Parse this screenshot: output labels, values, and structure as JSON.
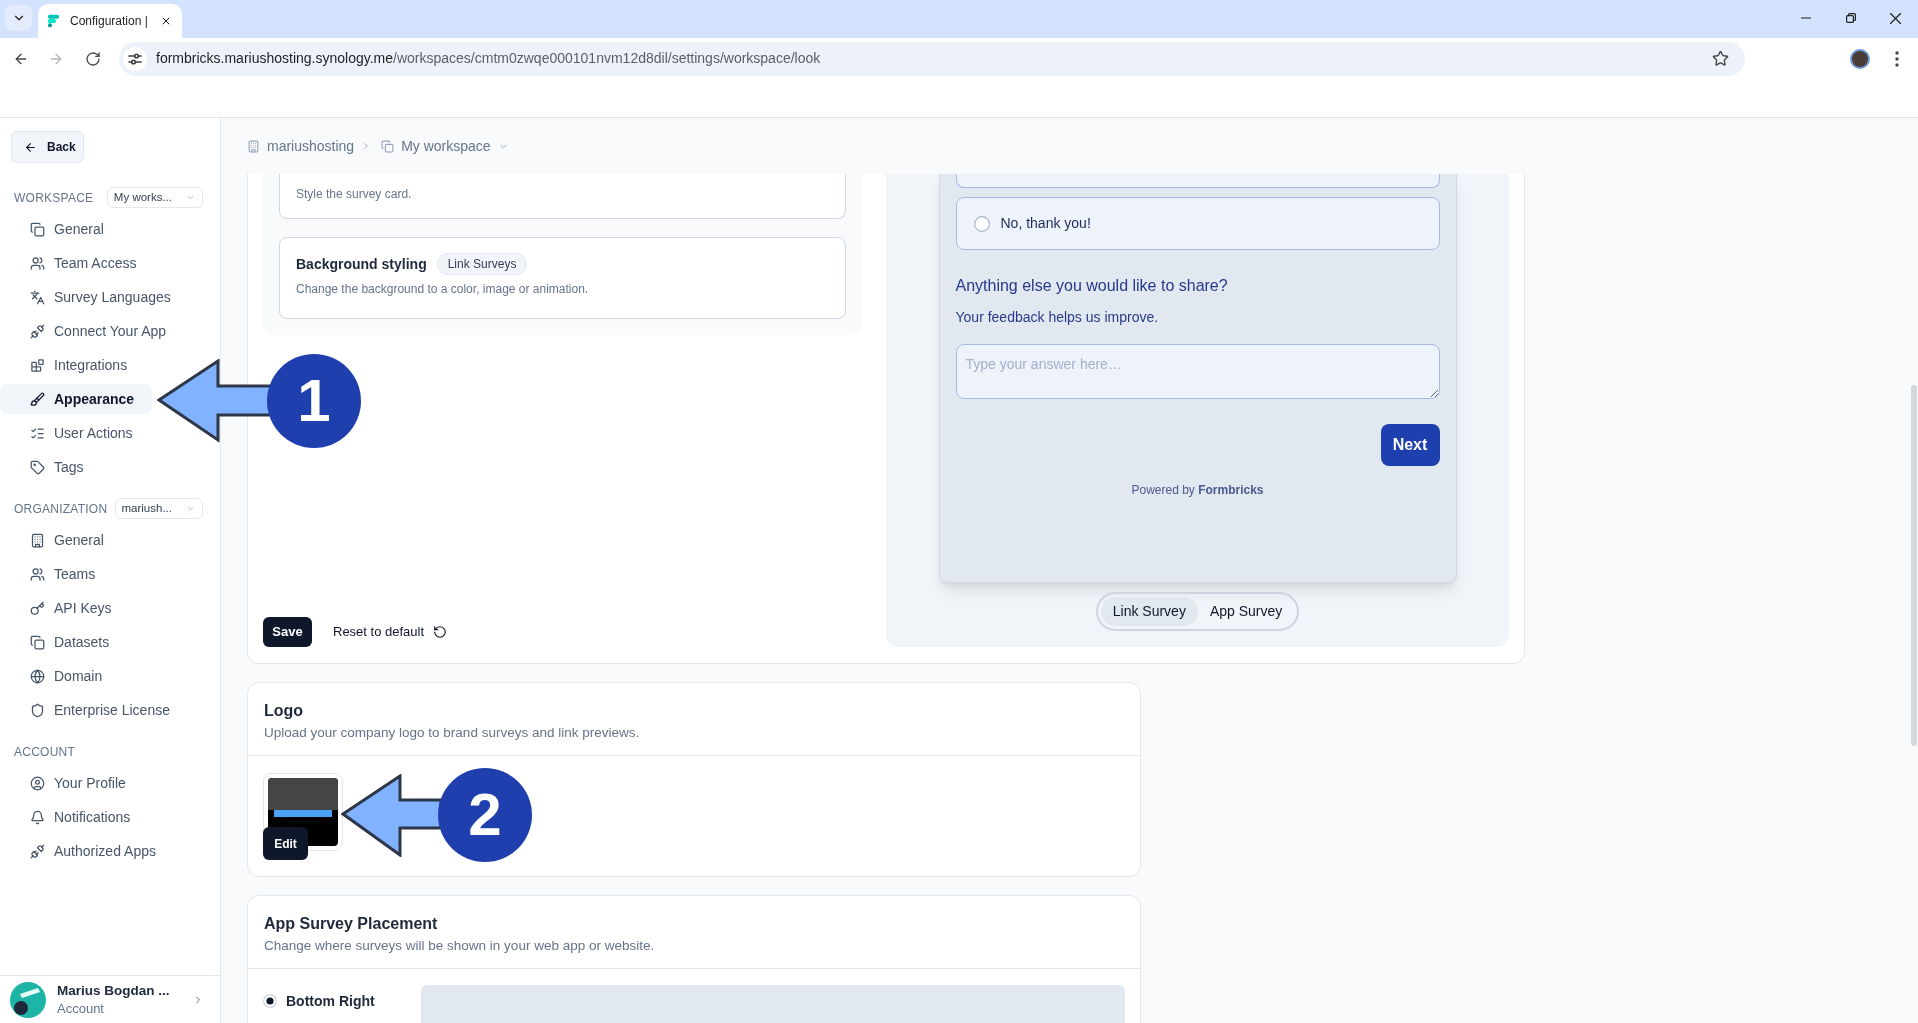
{
  "browser": {
    "tabs": [
      {
        "title": "Configuration |",
        "selected": true
      }
    ],
    "forward_disabled": true,
    "address": {
      "host": "formbricks.mariushosting.synology.me",
      "path": "/workspaces/cmtm0zwqe000101nvm12d8dil/settings/workspace/look"
    }
  },
  "sidebar": {
    "back": "Back",
    "sections": [
      {
        "label": "WORKSPACE",
        "selector": "My works...",
        "items": [
          {
            "label": "General",
            "selected": false
          },
          {
            "label": "Team Access",
            "selected": false
          },
          {
            "label": "Survey Languages",
            "selected": false
          },
          {
            "label": "Connect Your App",
            "selected": false
          },
          {
            "label": "Integrations",
            "selected": false
          },
          {
            "label": "Appearance",
            "selected": true
          },
          {
            "label": "User Actions",
            "selected": false
          },
          {
            "label": "Tags",
            "selected": false
          }
        ]
      },
      {
        "label": "ORGANIZATION",
        "selector": "mariush...",
        "items": [
          {
            "label": "General",
            "selected": false
          },
          {
            "label": "Teams",
            "selected": false
          },
          {
            "label": "API Keys",
            "selected": false
          },
          {
            "label": "Datasets",
            "selected": false
          },
          {
            "label": "Domain",
            "selected": false
          },
          {
            "label": "Enterprise License",
            "selected": false
          }
        ]
      },
      {
        "label": "ACCOUNT",
        "items": [
          {
            "label": "Your Profile",
            "selected": false
          },
          {
            "label": "Notifications",
            "selected": false
          },
          {
            "label": "Authorized Apps",
            "selected": false
          }
        ]
      }
    ],
    "user": {
      "name": "Marius Bogdan ...",
      "role": "Account"
    }
  },
  "breadcrumb": [
    {
      "label": "mariushosting",
      "dropdown": false
    },
    {
      "label": "My workspace",
      "dropdown": true
    }
  ],
  "styling": {
    "cards": [
      {
        "description": "Style the survey card."
      },
      {
        "title": "Background styling",
        "badge": "Link Surveys",
        "description": "Change the background to a color, image or animation."
      }
    ],
    "save": "Save",
    "reset": "Reset to default"
  },
  "preview": {
    "options": [
      {
        "label": "No, thank you!",
        "selected": false
      }
    ],
    "question": "Anything else you would like to share?",
    "subheader": "Your feedback helps us improve.",
    "answer": {
      "placeholder": "Type your answer here…"
    },
    "next": "Next",
    "powered_by": "Powered by **Formbricks**",
    "tabs": [
      {
        "label": "Link Survey",
        "selected": true
      },
      {
        "label": "App Survey",
        "selected": false
      }
    ]
  },
  "logo": {
    "title": "Logo",
    "description": "Upload your company logo to brand surveys and link previews.",
    "edit": "Edit"
  },
  "placement": {
    "title": "App Survey Placement",
    "description": "Change where surveys will be shown in your web app or website.",
    "options": [
      {
        "label": "Bottom Right",
        "selected": true
      }
    ]
  },
  "annotations": [
    {
      "number": "1"
    },
    {
      "number": "2"
    }
  ]
}
